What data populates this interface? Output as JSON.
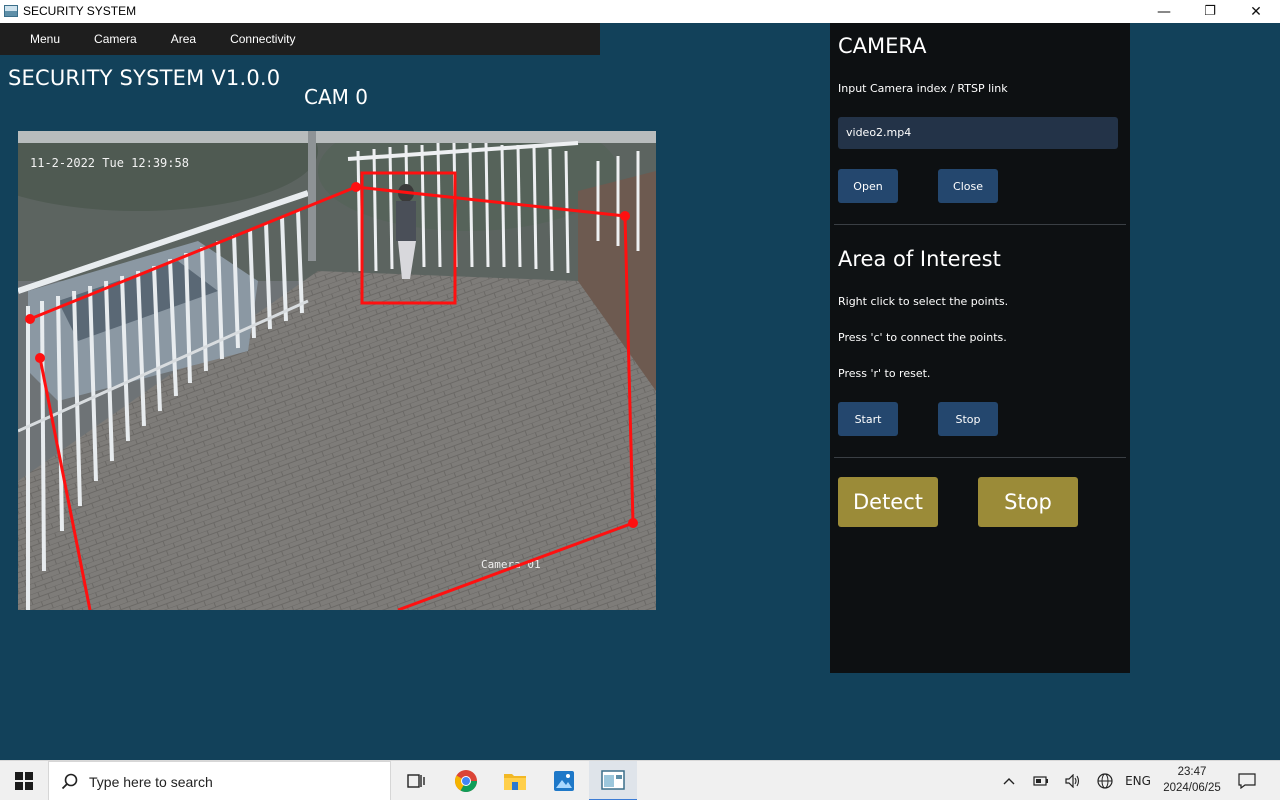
{
  "window": {
    "title": "SECURITY SYSTEM",
    "minimize": "—",
    "restore": "❐",
    "close": "✕"
  },
  "menubar": {
    "items": [
      "Menu",
      "Camera",
      "Area",
      "Connectivity"
    ]
  },
  "app_title": "SECURITY SYSTEM V1.0.0",
  "cam_title": "CAM 0",
  "video": {
    "timestamp": "11-2-2022 Tue 12:39:58",
    "camera_label": "Camera 01"
  },
  "panel": {
    "camera_heading": "CAMERA",
    "input_label": "Input Camera index / RTSP link",
    "input_value": "video2.mp4",
    "open_label": "Open",
    "close_label": "Close",
    "aoi_heading": "Area of Interest",
    "instr1": "Right click to select the points.",
    "instr2": "Press 'c' to connect the points.",
    "instr3": "Press 'r' to reset.",
    "start_label": "Start",
    "stop_label": "Stop",
    "detect_label": "Detect",
    "stop_big_label": "Stop"
  },
  "taskbar": {
    "search_placeholder": "Type here to search",
    "tray_lang": "ENG",
    "time": "23:47",
    "date": "2024/06/25"
  },
  "colors": {
    "accent_button": "#24476e",
    "detect_button": "#9b8b38",
    "background": "#12415a",
    "panel": "#0d1012",
    "overlay": "#ff0000"
  }
}
